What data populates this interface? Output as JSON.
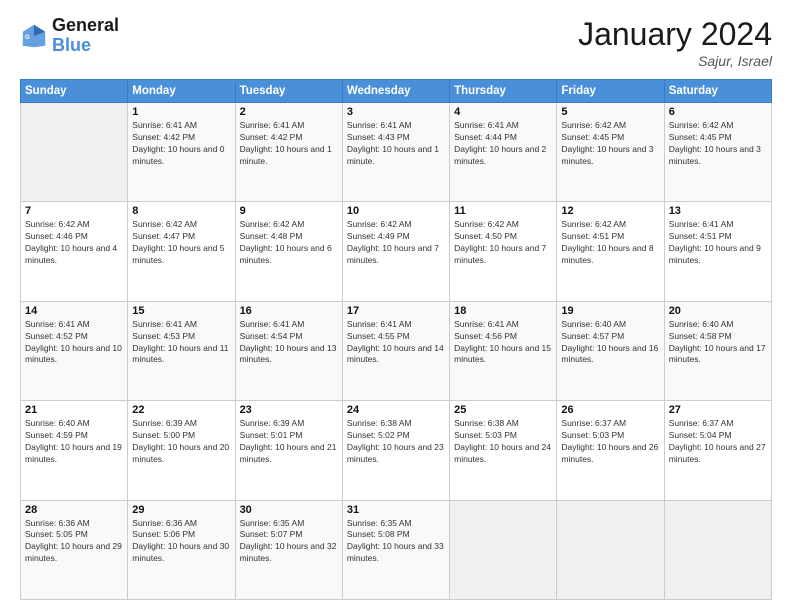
{
  "logo": {
    "line1": "General",
    "line2": "Blue"
  },
  "header": {
    "month_title": "January 2024",
    "location": "Sajur, Israel"
  },
  "weekdays": [
    "Sunday",
    "Monday",
    "Tuesday",
    "Wednesday",
    "Thursday",
    "Friday",
    "Saturday"
  ],
  "weeks": [
    [
      {
        "day": "",
        "sunrise": "",
        "sunset": "",
        "daylight": ""
      },
      {
        "day": "1",
        "sunrise": "Sunrise: 6:41 AM",
        "sunset": "Sunset: 4:42 PM",
        "daylight": "Daylight: 10 hours and 0 minutes."
      },
      {
        "day": "2",
        "sunrise": "Sunrise: 6:41 AM",
        "sunset": "Sunset: 4:42 PM",
        "daylight": "Daylight: 10 hours and 1 minute."
      },
      {
        "day": "3",
        "sunrise": "Sunrise: 6:41 AM",
        "sunset": "Sunset: 4:43 PM",
        "daylight": "Daylight: 10 hours and 1 minute."
      },
      {
        "day": "4",
        "sunrise": "Sunrise: 6:41 AM",
        "sunset": "Sunset: 4:44 PM",
        "daylight": "Daylight: 10 hours and 2 minutes."
      },
      {
        "day": "5",
        "sunrise": "Sunrise: 6:42 AM",
        "sunset": "Sunset: 4:45 PM",
        "daylight": "Daylight: 10 hours and 3 minutes."
      },
      {
        "day": "6",
        "sunrise": "Sunrise: 6:42 AM",
        "sunset": "Sunset: 4:45 PM",
        "daylight": "Daylight: 10 hours and 3 minutes."
      }
    ],
    [
      {
        "day": "7",
        "sunrise": "Sunrise: 6:42 AM",
        "sunset": "Sunset: 4:46 PM",
        "daylight": "Daylight: 10 hours and 4 minutes."
      },
      {
        "day": "8",
        "sunrise": "Sunrise: 6:42 AM",
        "sunset": "Sunset: 4:47 PM",
        "daylight": "Daylight: 10 hours and 5 minutes."
      },
      {
        "day": "9",
        "sunrise": "Sunrise: 6:42 AM",
        "sunset": "Sunset: 4:48 PM",
        "daylight": "Daylight: 10 hours and 6 minutes."
      },
      {
        "day": "10",
        "sunrise": "Sunrise: 6:42 AM",
        "sunset": "Sunset: 4:49 PM",
        "daylight": "Daylight: 10 hours and 7 minutes."
      },
      {
        "day": "11",
        "sunrise": "Sunrise: 6:42 AM",
        "sunset": "Sunset: 4:50 PM",
        "daylight": "Daylight: 10 hours and 7 minutes."
      },
      {
        "day": "12",
        "sunrise": "Sunrise: 6:42 AM",
        "sunset": "Sunset: 4:51 PM",
        "daylight": "Daylight: 10 hours and 8 minutes."
      },
      {
        "day": "13",
        "sunrise": "Sunrise: 6:41 AM",
        "sunset": "Sunset: 4:51 PM",
        "daylight": "Daylight: 10 hours and 9 minutes."
      }
    ],
    [
      {
        "day": "14",
        "sunrise": "Sunrise: 6:41 AM",
        "sunset": "Sunset: 4:52 PM",
        "daylight": "Daylight: 10 hours and 10 minutes."
      },
      {
        "day": "15",
        "sunrise": "Sunrise: 6:41 AM",
        "sunset": "Sunset: 4:53 PM",
        "daylight": "Daylight: 10 hours and 11 minutes."
      },
      {
        "day": "16",
        "sunrise": "Sunrise: 6:41 AM",
        "sunset": "Sunset: 4:54 PM",
        "daylight": "Daylight: 10 hours and 13 minutes."
      },
      {
        "day": "17",
        "sunrise": "Sunrise: 6:41 AM",
        "sunset": "Sunset: 4:55 PM",
        "daylight": "Daylight: 10 hours and 14 minutes."
      },
      {
        "day": "18",
        "sunrise": "Sunrise: 6:41 AM",
        "sunset": "Sunset: 4:56 PM",
        "daylight": "Daylight: 10 hours and 15 minutes."
      },
      {
        "day": "19",
        "sunrise": "Sunrise: 6:40 AM",
        "sunset": "Sunset: 4:57 PM",
        "daylight": "Daylight: 10 hours and 16 minutes."
      },
      {
        "day": "20",
        "sunrise": "Sunrise: 6:40 AM",
        "sunset": "Sunset: 4:58 PM",
        "daylight": "Daylight: 10 hours and 17 minutes."
      }
    ],
    [
      {
        "day": "21",
        "sunrise": "Sunrise: 6:40 AM",
        "sunset": "Sunset: 4:59 PM",
        "daylight": "Daylight: 10 hours and 19 minutes."
      },
      {
        "day": "22",
        "sunrise": "Sunrise: 6:39 AM",
        "sunset": "Sunset: 5:00 PM",
        "daylight": "Daylight: 10 hours and 20 minutes."
      },
      {
        "day": "23",
        "sunrise": "Sunrise: 6:39 AM",
        "sunset": "Sunset: 5:01 PM",
        "daylight": "Daylight: 10 hours and 21 minutes."
      },
      {
        "day": "24",
        "sunrise": "Sunrise: 6:38 AM",
        "sunset": "Sunset: 5:02 PM",
        "daylight": "Daylight: 10 hours and 23 minutes."
      },
      {
        "day": "25",
        "sunrise": "Sunrise: 6:38 AM",
        "sunset": "Sunset: 5:03 PM",
        "daylight": "Daylight: 10 hours and 24 minutes."
      },
      {
        "day": "26",
        "sunrise": "Sunrise: 6:37 AM",
        "sunset": "Sunset: 5:03 PM",
        "daylight": "Daylight: 10 hours and 26 minutes."
      },
      {
        "day": "27",
        "sunrise": "Sunrise: 6:37 AM",
        "sunset": "Sunset: 5:04 PM",
        "daylight": "Daylight: 10 hours and 27 minutes."
      }
    ],
    [
      {
        "day": "28",
        "sunrise": "Sunrise: 6:36 AM",
        "sunset": "Sunset: 5:05 PM",
        "daylight": "Daylight: 10 hours and 29 minutes."
      },
      {
        "day": "29",
        "sunrise": "Sunrise: 6:36 AM",
        "sunset": "Sunset: 5:06 PM",
        "daylight": "Daylight: 10 hours and 30 minutes."
      },
      {
        "day": "30",
        "sunrise": "Sunrise: 6:35 AM",
        "sunset": "Sunset: 5:07 PM",
        "daylight": "Daylight: 10 hours and 32 minutes."
      },
      {
        "day": "31",
        "sunrise": "Sunrise: 6:35 AM",
        "sunset": "Sunset: 5:08 PM",
        "daylight": "Daylight: 10 hours and 33 minutes."
      },
      {
        "day": "",
        "sunrise": "",
        "sunset": "",
        "daylight": ""
      },
      {
        "day": "",
        "sunrise": "",
        "sunset": "",
        "daylight": ""
      },
      {
        "day": "",
        "sunrise": "",
        "sunset": "",
        "daylight": ""
      }
    ]
  ]
}
